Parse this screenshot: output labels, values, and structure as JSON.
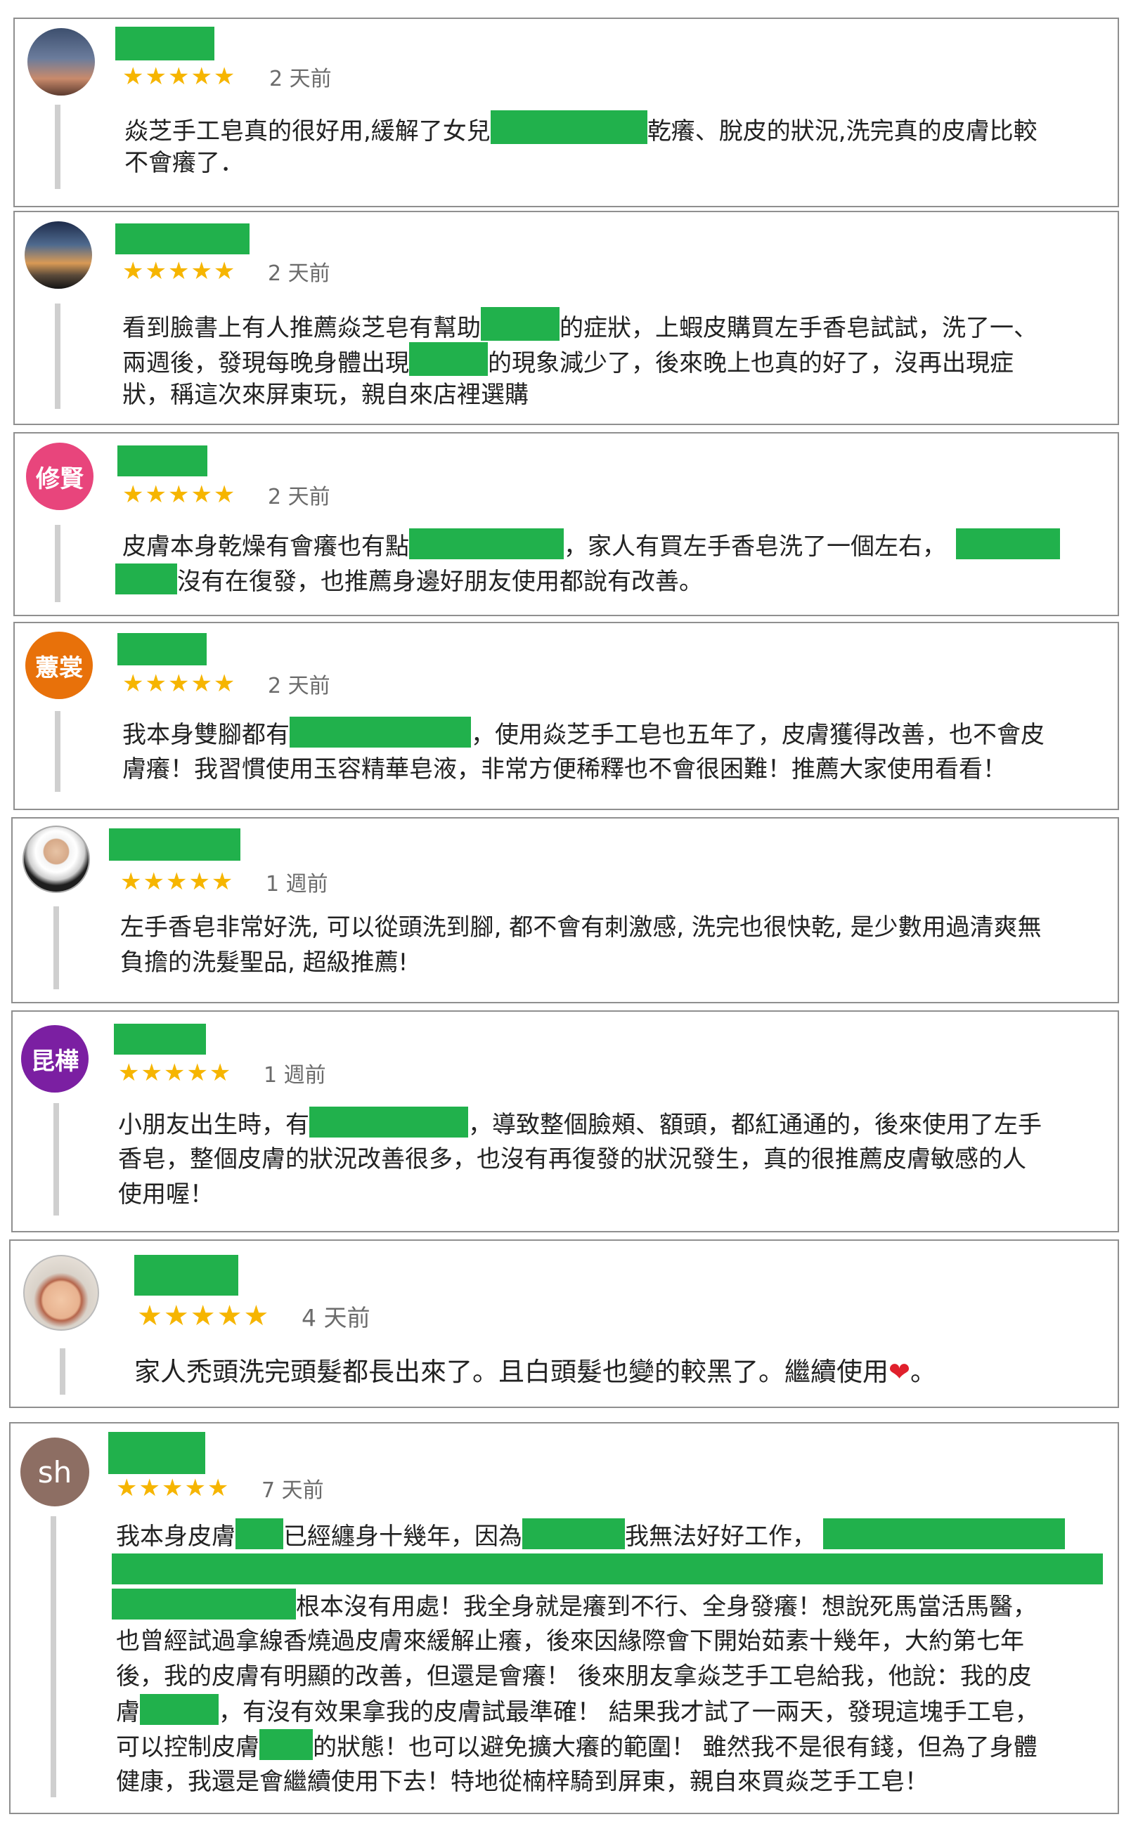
{
  "colors": {
    "redaction": "#21b14c",
    "star": "#f6b500",
    "border": "#8f8f8f",
    "heart": "#e0202c"
  },
  "star_glyphs": "★★★★★",
  "reviews": [
    {
      "rating": 5,
      "time": "2 天前",
      "lines": [
        [
          "焱芝手工皂真的很好用,緩解了女兒",
          "乾癢、脫皮的狀況,洗完真的皮膚比較"
        ],
        [
          "不會癢了．"
        ]
      ]
    },
    {
      "rating": 5,
      "time": "2 天前",
      "lines": [
        [
          "看到臉書上有人推薦焱芝皂有幫助",
          "的症狀，上蝦皮購買左手香皂試試，洗了一、"
        ],
        [
          "兩週後，發現每晚身體出現",
          "的現象減少了，後來晚上也真的好了，沒再出現症"
        ],
        [
          "狀，稱這次來屏東玩，親自來店裡選購"
        ]
      ]
    },
    {
      "avatar_text": "修賢",
      "avatar_color": "#e8457c",
      "rating": 5,
      "time": "2 天前",
      "lines": [
        [
          "皮膚本身乾燥有會癢也有點",
          "，家人有買左手香皂洗了一個左右，",
          ""
        ],
        [
          "",
          "沒有在復發，也推薦身邊好朋友使用都說有改善。"
        ]
      ]
    },
    {
      "avatar_text": "藼裳",
      "avatar_color": "#e8710a",
      "rating": 5,
      "time": "2 天前",
      "lines": [
        [
          "我本身雙腳都有",
          "，使用焱芝手工皂也五年了，皮膚獲得改善，也不會皮"
        ],
        [
          "膚癢！我習慣使用玉容精華皂液，非常方便稀釋也不會很困難！推薦大家使用看看！"
        ]
      ]
    },
    {
      "rating": 5,
      "time": "1 週前",
      "lines": [
        [
          "左手香皂非常好洗, 可以從頭洗到腳, 都不會有刺激感, 洗完也很快乾, 是少數用過清爽無"
        ],
        [
          "負擔的洗髮聖品, 超級推薦!"
        ]
      ]
    },
    {
      "avatar_text": "昆樺",
      "avatar_color": "#7b1fa2",
      "rating": 5,
      "time": "1 週前",
      "lines": [
        [
          "小朋友出生時，有",
          "，導致整個臉頰、額頭，都紅通通的，後來使用了左手"
        ],
        [
          "香皂，整個皮膚的狀況改善很多，也沒有再復發的狀況發生，真的很推薦皮膚敏感的人"
        ],
        [
          "使用喔！"
        ]
      ]
    },
    {
      "rating": 5,
      "time": "4 天前",
      "lines": [
        [
          "家人禿頭洗完頭髮都長出來了。且白頭髮也變的較黑了。繼續使用",
          "。"
        ]
      ],
      "heart": "❤"
    },
    {
      "avatar_text": "sh",
      "avatar_color": "#8d6e63",
      "rating": 5,
      "time": "7 天前",
      "lines": [
        [
          "我本身皮膚",
          "已經纏身十幾年，因為",
          "我無法好好工作，",
          ""
        ],
        [
          ""
        ],
        [
          "",
          "根本沒有用處！我全身就是癢到不行、全身發癢！想說死馬當活馬醫，"
        ],
        [
          "也曾經試過拿線香燒過皮膚來緩解止癢，後來因緣際會下開始茹素十幾年，大約第七年"
        ],
        [
          "後，我的皮膚有明顯的改善，但還是會癢！ 後來朋友拿焱芝手工皂給我，他說：我的皮"
        ],
        [
          "膚",
          "，有沒有效果拿我的皮膚試最準確！ 結果我才試了一兩天，發現這塊手工皂，"
        ],
        [
          "可以控制皮膚",
          "的狀態！也可以避免擴大癢的範圍！ 雖然我不是很有錢，但為了身體"
        ],
        [
          "健康，我還是會繼續使用下去！特地從楠梓騎到屏東，親自來買焱芝手工皂！"
        ]
      ]
    }
  ]
}
